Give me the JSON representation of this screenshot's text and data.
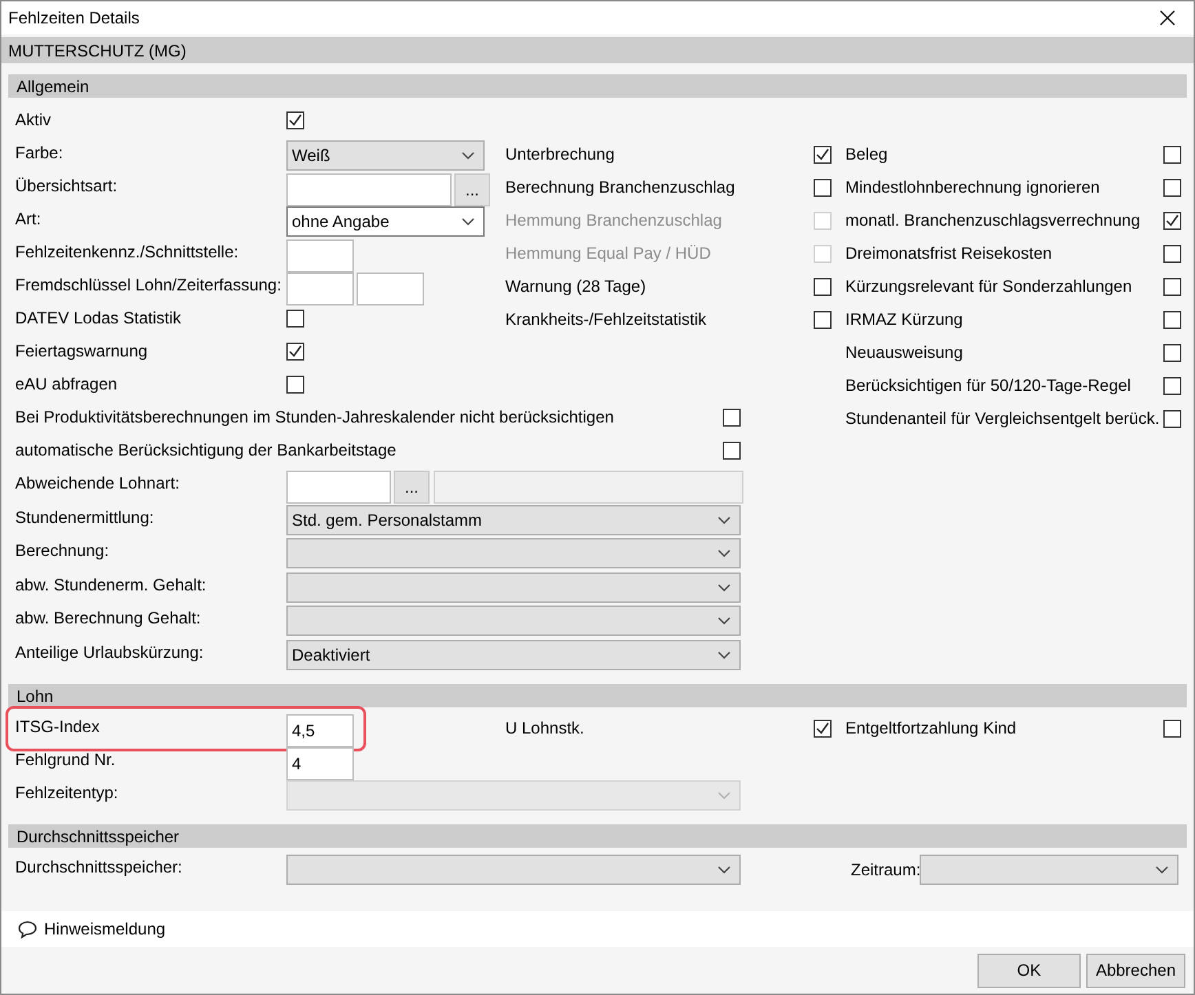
{
  "window": {
    "title": "Fehlzeiten Details"
  },
  "record_title": "MUTTERSCHUTZ (MG)",
  "sections": [
    {
      "title": "Allgemein",
      "rows": [
        {
          "left": {
            "kind": "checkbox",
            "label": "Aktiv",
            "checked": true
          }
        },
        {
          "left": {
            "kind": "select",
            "label": "Farbe:",
            "value": "Weiß",
            "focused": false
          },
          "middle": {
            "label": "Unterbrechung",
            "checked": true,
            "disabled": false
          },
          "right": {
            "label": "Beleg",
            "checked": false
          }
        },
        {
          "left": {
            "kind": "lookup",
            "label": "Übersichtsart:",
            "button": "..."
          },
          "middle": {
            "label": "Berechnung Branchenzuschlag",
            "checked": false,
            "disabled": false
          },
          "right": {
            "label": "Mindestlohnberechnung ignorieren",
            "checked": false
          }
        },
        {
          "left": {
            "kind": "select",
            "label": "Art:",
            "value": "ohne Angabe",
            "focused": true
          },
          "middle": {
            "label": "Hemmung Branchenzuschlag",
            "checked": false,
            "disabled": true
          },
          "right": {
            "label": "monatl. Branchenzuschlagsverrechnung",
            "checked": true
          }
        },
        {
          "left": {
            "kind": "field",
            "label": "Fehlzeitenkennz./Schnittstelle:"
          },
          "middle": {
            "label": "Hemmung Equal Pay / HÜD",
            "checked": false,
            "disabled": true
          },
          "right": {
            "label": "Dreimonatsfrist Reisekosten",
            "checked": false
          }
        },
        {
          "left": {
            "kind": "field_pair",
            "label": "Fremdschlüssel Lohn/Zeiterfassung:"
          },
          "middle": {
            "label": "Warnung (28 Tage)",
            "checked": false,
            "disabled": false
          },
          "right": {
            "label": "Kürzungsrelevant für Sonderzahlungen",
            "checked": false
          }
        },
        {
          "left": {
            "kind": "checkbox",
            "label": "DATEV Lodas Statistik",
            "checked": false
          },
          "middle": {
            "label": "Krankheits-/Fehlzeitstatistik",
            "checked": false,
            "disabled": false
          },
          "right": {
            "label": "IRMAZ Kürzung",
            "checked": false
          }
        },
        {
          "left": {
            "kind": "checkbox",
            "label": "Feiertagswarnung",
            "checked": true
          },
          "right": {
            "label": "Neuausweisung",
            "checked": false
          }
        },
        {
          "left": {
            "kind": "checkbox",
            "label": "eAU abfragen",
            "checked": false
          },
          "right": {
            "label": "Berücksichtigen für 50/120-Tage-Regel",
            "checked": false
          }
        },
        {
          "left": {
            "kind": "wide_checkbox",
            "label": "Bei Produktivitätsberechnungen im Stunden-Jahreskalender nicht berücksichtigen",
            "checked": false
          },
          "right": {
            "label": "Stundenanteil für Vergleichsentgelt berück.",
            "checked": false
          }
        },
        {
          "left": {
            "kind": "wide_checkbox",
            "label": "automatische Berücksichtigung der Bankarbeitstage",
            "checked": false
          }
        },
        {
          "left": {
            "kind": "wide_lookup",
            "label": "Abweichende Lohnart:",
            "button": "..."
          }
        },
        {
          "left": {
            "kind": "wide_select",
            "label": "Stundenermittlung:",
            "value": "Std. gem. Personalstamm",
            "disabled": false
          }
        },
        {
          "left": {
            "kind": "wide_select",
            "label": "Berechnung:",
            "disabled": false
          }
        },
        {
          "left": {
            "kind": "wide_select",
            "label": "abw. Stundenerm. Gehalt:",
            "disabled": false
          }
        },
        {
          "left": {
            "kind": "wide_select",
            "label": "abw. Berechnung Gehalt:",
            "disabled": false
          }
        },
        {
          "left": {
            "kind": "wide_select",
            "label": "Anteilige Urlaubskürzung:",
            "value": "Deaktiviert",
            "disabled": false
          }
        }
      ]
    },
    {
      "title": "Lohn",
      "rows": [
        {
          "left": {
            "kind": "field",
            "label": "ITSG-Index",
            "value": "4,5",
            "highlighted": true
          },
          "middle": {
            "label": "U Lohnstk.",
            "checked": true,
            "disabled": false
          },
          "right": {
            "label": "Entgeltfortzahlung Kind",
            "checked": false
          }
        },
        {
          "left": {
            "kind": "field",
            "label": "Fehlgrund Nr.",
            "value": "4"
          }
        },
        {
          "left": {
            "kind": "wide_select",
            "label": "Fehlzeitentyp:",
            "disabled": true
          }
        }
      ]
    },
    {
      "title": "Durchschnittsspeicher",
      "rows": [
        {
          "left": {
            "kind": "wide_select",
            "label": "Durchschnittsspeicher:",
            "disabled": false
          },
          "extra": {
            "kind": "select",
            "label": "Zeitraum:"
          }
        }
      ]
    }
  ],
  "hint": "Hinweismeldung",
  "buttons": [
    "OK",
    "Abbrechen"
  ]
}
